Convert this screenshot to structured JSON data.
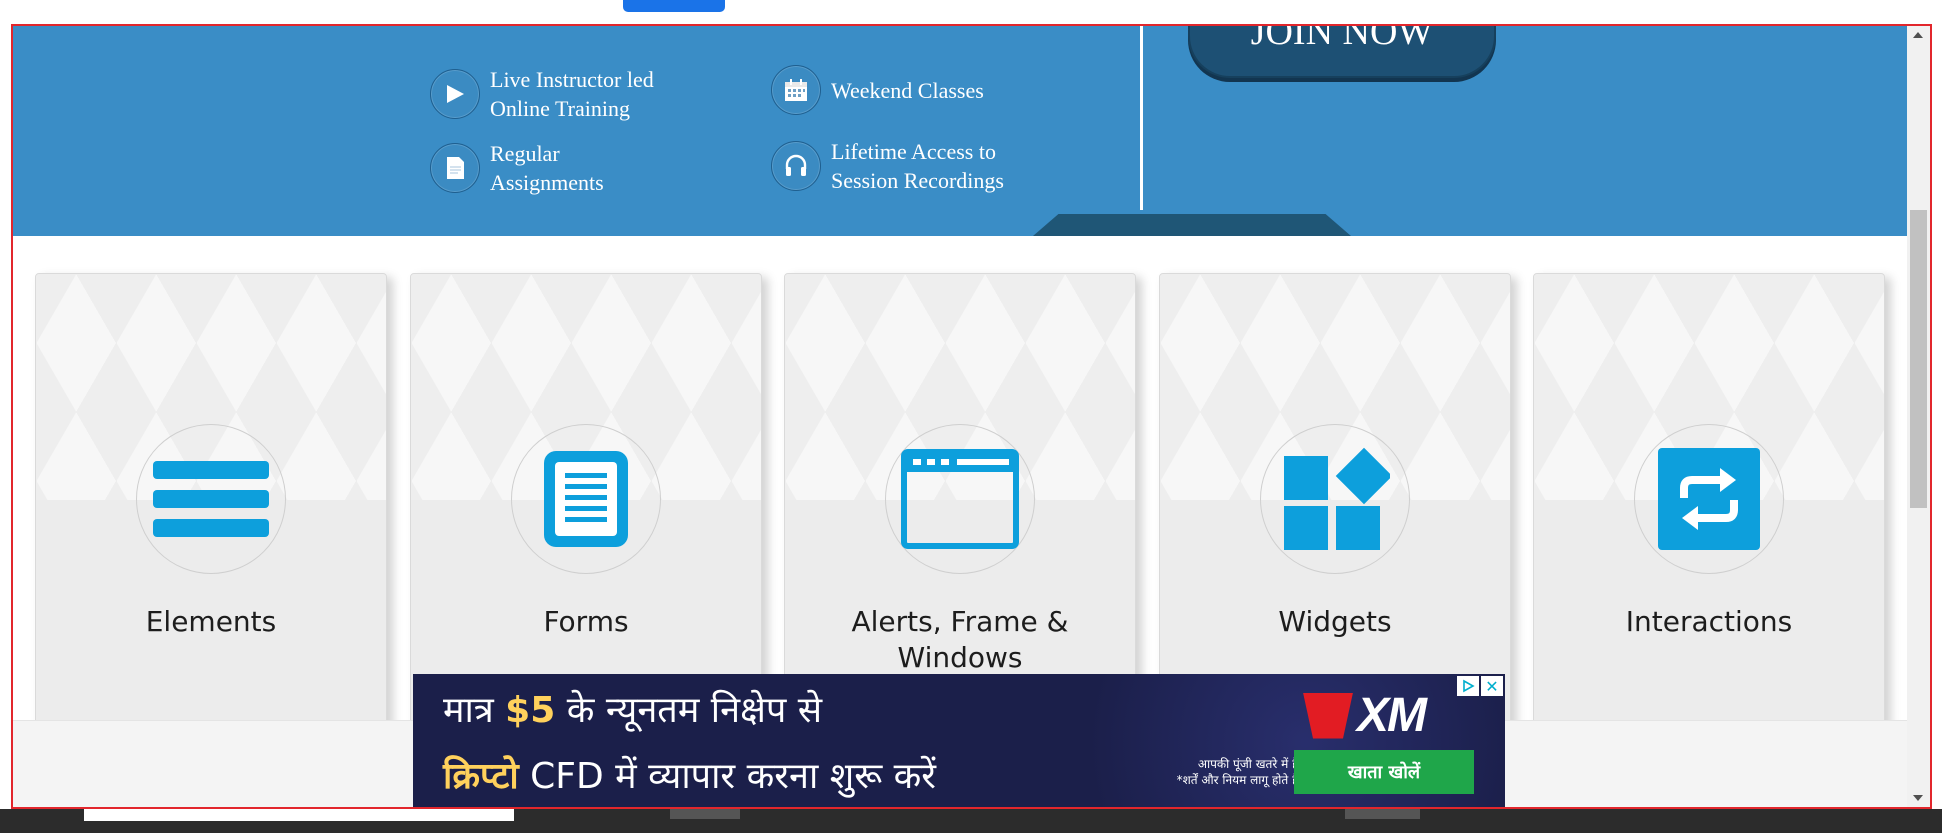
{
  "banner": {
    "features": [
      {
        "icon": "play-icon",
        "text": [
          "Live Instructor led",
          "Online Training"
        ]
      },
      {
        "icon": "calendar-icon",
        "text": [
          "Weekend Classes"
        ]
      },
      {
        "icon": "document-icon",
        "text": [
          "Regular",
          "Assignments"
        ]
      },
      {
        "icon": "headphones-icon",
        "text": [
          "Lifetime Access to",
          "Session Recordings"
        ]
      }
    ],
    "join_button": "JOIN NOW"
  },
  "cards": [
    {
      "title": "Elements",
      "icon": "hamburger-list-icon"
    },
    {
      "title": "Forms",
      "icon": "form-document-icon"
    },
    {
      "title_lines": [
        "Alerts, Frame &",
        "Windows"
      ],
      "icon": "browser-window-icon"
    },
    {
      "title": "Widgets",
      "icon": "widgets-blocks-icon"
    },
    {
      "title": "Interactions",
      "icon": "swap-arrows-icon"
    }
  ],
  "ad": {
    "line1_prefix": "मात्र ",
    "line1_amount": "$5",
    "line1_suffix": " के न्यूनतम निक्षेप से",
    "line2_crypto": "क्रिप्टो",
    "line2_suffix": " CFD में  व्यापार करना शुरू करें",
    "brand": "XM",
    "disclaimer": [
      "आपकी पूंजी खतरे में है।",
      "*शर्तें और नियम लागू होते हैं।"
    ],
    "cta": "खाता खोलें",
    "close_symbol": "✕"
  },
  "colors": {
    "banner_blue": "#3a8dc6",
    "icon_blue": "#0d9fdc",
    "join_button": "#1d5074",
    "frame_border": "#e2262c",
    "ad_cta": "#1fa64a"
  }
}
